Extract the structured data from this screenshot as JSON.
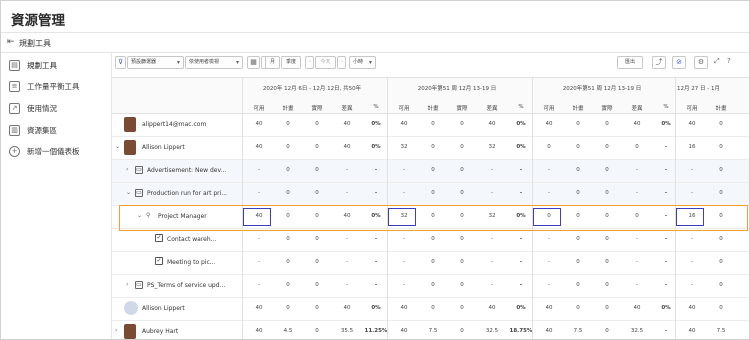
{
  "page": {
    "title": "資源管理"
  },
  "subbar": {
    "label": "規劃工具"
  },
  "sidebar": {
    "items": [
      {
        "label": "規劃工具",
        "icon": "planner-icon"
      },
      {
        "label": "工作量平衡工具",
        "icon": "balance-icon"
      },
      {
        "label": "使用情況",
        "icon": "chart-icon"
      },
      {
        "label": "資源集區",
        "icon": "pool-icon"
      },
      {
        "label": "新增一個儀表板",
        "icon": "plus-icon"
      }
    ]
  },
  "toolbar": {
    "filter_label": "預設篩選器",
    "view_label": "依使用者檢視",
    "range": [
      "日",
      "月",
      "季度"
    ],
    "prev_label": "今天",
    "unit_label": "小時",
    "export_label": "匯出"
  },
  "weeks": [
    {
      "title": "2020年 12月 6日 - 12月 12日, 共50年"
    },
    {
      "title": "2020年第51 周 12月 13-19 日"
    },
    {
      "title": "2020年第51 周 12月 13-19 日"
    },
    {
      "title": "12月 27 日 - 1月"
    }
  ],
  "columns": [
    "可用",
    "計畫",
    "實際",
    "差異",
    "%"
  ],
  "rows": [
    {
      "name": "alippert14@mac.com",
      "type": "user",
      "w1": [
        "40",
        "0",
        "0",
        "40",
        "0%"
      ],
      "w2": [
        "40",
        "0",
        "0",
        "40",
        "0%"
      ],
      "w3": [
        "40",
        "0",
        "0",
        "40",
        "0%"
      ],
      "w4": [
        "40",
        "0"
      ]
    },
    {
      "name": "Allison Lippert",
      "type": "user",
      "w1": [
        "40",
        "0",
        "0",
        "40",
        "0%"
      ],
      "w2": [
        "32",
        "0",
        "0",
        "32",
        "0%"
      ],
      "w3": [
        "0",
        "0",
        "0",
        "0",
        "-"
      ],
      "w4": [
        "16",
        "0"
      ]
    },
    {
      "name": "Advertisement: New dev...",
      "type": "project",
      "w1": [
        "-",
        "0",
        "0",
        "-",
        "-"
      ],
      "w2": [
        "-",
        "0",
        "0",
        "-",
        "-"
      ],
      "w3": [
        "-",
        "0",
        "0",
        "-",
        "-"
      ],
      "w4": [
        "-",
        "0"
      ]
    },
    {
      "name": "Production run for art pri...",
      "type": "project",
      "w1": [
        "-",
        "0",
        "0",
        "-",
        "-"
      ],
      "w2": [
        "-",
        "0",
        "0",
        "-",
        "-"
      ],
      "w3": [
        "-",
        "0",
        "0",
        "-",
        "-"
      ],
      "w4": [
        "-",
        "0"
      ]
    },
    {
      "name": "Project Manager",
      "type": "role",
      "w1": [
        "40",
        "0",
        "0",
        "40",
        "0%"
      ],
      "w2": [
        "32",
        "0",
        "0",
        "32",
        "0%"
      ],
      "w3": [
        "0",
        "0",
        "0",
        "0",
        "-"
      ],
      "w4": [
        "16",
        "0"
      ]
    },
    {
      "name": "Contact wareh...",
      "type": "task",
      "w1": [
        "-",
        "0",
        "0",
        "-",
        "-"
      ],
      "w2": [
        "-",
        "0",
        "0",
        "-",
        "-"
      ],
      "w3": [
        "-",
        "0",
        "0",
        "-",
        "-"
      ],
      "w4": [
        "-",
        "0"
      ]
    },
    {
      "name": "Meeting to pic...",
      "type": "task",
      "w1": [
        "-",
        "0",
        "0",
        "-",
        "-"
      ],
      "w2": [
        "-",
        "0",
        "0",
        "-",
        "-"
      ],
      "w3": [
        "-",
        "0",
        "0",
        "-",
        "-"
      ],
      "w4": [
        "-",
        "0"
      ]
    },
    {
      "name": "PS_Terms of service upd...",
      "type": "project",
      "w1": [
        "-",
        "0",
        "0",
        "-",
        "-"
      ],
      "w2": [
        "-",
        "0",
        "0",
        "-",
        "-"
      ],
      "w3": [
        "-",
        "0",
        "0",
        "-",
        "-"
      ],
      "w4": [
        "-",
        "0"
      ]
    },
    {
      "name": "Allison Lippert",
      "type": "user2",
      "w1": [
        "40",
        "0",
        "0",
        "40",
        "0%"
      ],
      "w2": [
        "40",
        "0",
        "0",
        "40",
        "0%"
      ],
      "w3": [
        "40",
        "0",
        "0",
        "40",
        "0%"
      ],
      "w4": [
        "40",
        "0"
      ]
    },
    {
      "name": "Aubrey Hart",
      "type": "user",
      "w1": [
        "40",
        "4.5",
        "0",
        "35.5",
        "11.25%"
      ],
      "w2": [
        "40",
        "7.5",
        "0",
        "32.5",
        "18.75%"
      ],
      "w3": [
        "40",
        "7.5",
        "0",
        "32.5",
        "-"
      ],
      "w4": [
        "40",
        "7.5"
      ]
    }
  ]
}
